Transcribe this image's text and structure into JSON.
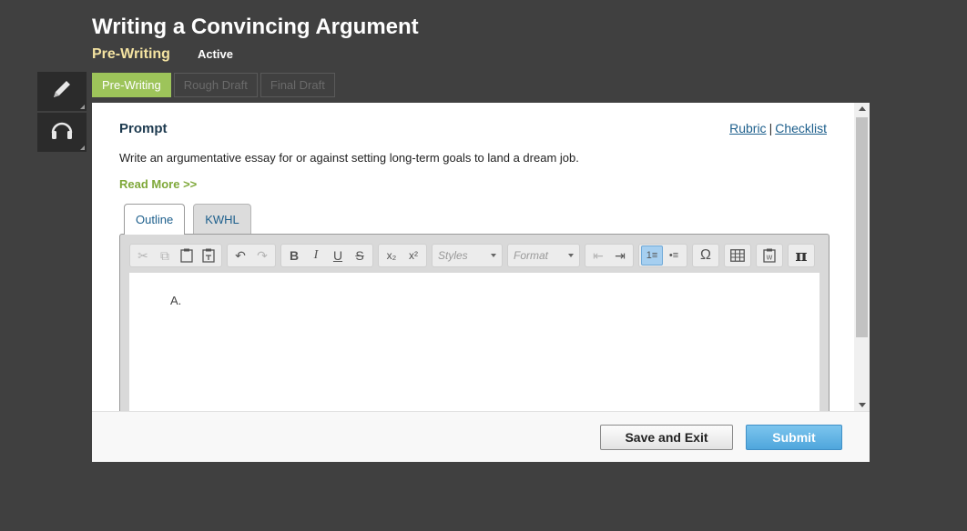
{
  "header": {
    "title": "Writing a Convincing Argument",
    "stage": "Pre-Writing",
    "status": "Active"
  },
  "side_tools": [
    {
      "icon": "pencil-icon"
    },
    {
      "icon": "headphones-icon"
    }
  ],
  "stage_tabs": [
    {
      "label": "Pre-Writing",
      "active": true
    },
    {
      "label": "Rough Draft",
      "active": false
    },
    {
      "label": "Final Draft",
      "active": false
    }
  ],
  "prompt": {
    "heading": "Prompt",
    "text": "Write an argumentative essay for or against setting long-term goals to land a dream job.",
    "read_more": "Read More >>",
    "rubric_link": "Rubric",
    "separator": "|",
    "checklist_link": "Checklist"
  },
  "note_tabs": [
    {
      "label": "Outline",
      "active": true
    },
    {
      "label": "KWHL",
      "active": false
    }
  ],
  "editor": {
    "styles_placeholder": "Styles",
    "format_placeholder": "Format",
    "outline_item": "A.",
    "buttons": {
      "cut": "✂",
      "copy": "⧉",
      "paste": "📋",
      "paste_text": "📋",
      "undo": "↶",
      "redo": "↷",
      "bold": "B",
      "italic": "I",
      "underline": "U",
      "strike": "S",
      "subscript": "x₂",
      "superscript": "x²",
      "outdent": "⇤",
      "indent": "⇥",
      "numbered_list": "1≡",
      "bulleted_list": "•≡",
      "special_char": "Ω",
      "table": "▦",
      "paste_word": "📋",
      "math": "π"
    }
  },
  "footer": {
    "save_label": "Save and Exit",
    "submit_label": "Submit"
  },
  "colors": {
    "background": "#404040",
    "accent_green": "#9dc45a",
    "link_blue": "#1d5f8c",
    "submit_blue": "#4fa6dc"
  }
}
